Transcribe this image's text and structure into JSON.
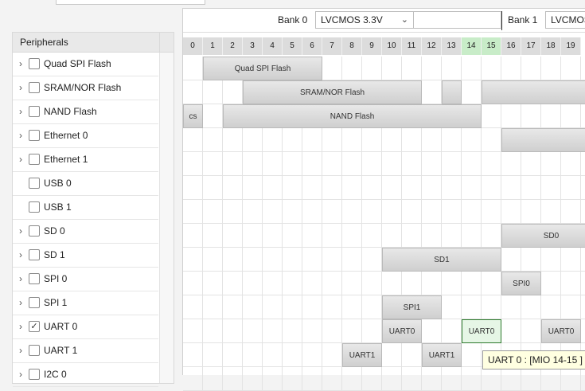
{
  "peripherals": {
    "header": "Peripherals",
    "items": [
      {
        "label": "Quad SPI Flash",
        "expandable": true,
        "checked": false
      },
      {
        "label": "SRAM/NOR Flash",
        "expandable": true,
        "checked": false
      },
      {
        "label": "NAND Flash",
        "expandable": true,
        "checked": false
      },
      {
        "label": "Ethernet 0",
        "expandable": true,
        "checked": false
      },
      {
        "label": "Ethernet 1",
        "expandable": true,
        "checked": false
      },
      {
        "label": "USB 0",
        "expandable": false,
        "checked": false
      },
      {
        "label": "USB 1",
        "expandable": false,
        "checked": false
      },
      {
        "label": "SD 0",
        "expandable": true,
        "checked": false
      },
      {
        "label": "SD 1",
        "expandable": true,
        "checked": false
      },
      {
        "label": "SPI 0",
        "expandable": true,
        "checked": false
      },
      {
        "label": "SPI 1",
        "expandable": true,
        "checked": false
      },
      {
        "label": "UART 0",
        "expandable": true,
        "checked": true
      },
      {
        "label": "UART 1",
        "expandable": true,
        "checked": false
      },
      {
        "label": "I2C 0",
        "expandable": true,
        "checked": false
      }
    ]
  },
  "banks": [
    {
      "label": "Bank 0",
      "voltage": "LVCMOS 3.3V"
    },
    {
      "label": "Bank 1",
      "voltage": "LVCMOS"
    }
  ],
  "mio_pins": [
    "0",
    "1",
    "2",
    "3",
    "4",
    "5",
    "6",
    "7",
    "8",
    "9",
    "10",
    "11",
    "12",
    "13",
    "14",
    "15",
    "16",
    "17",
    "18",
    "19"
  ],
  "highlight_pins": [
    14,
    15
  ],
  "segments": [
    {
      "row": 0,
      "from": 1,
      "to": 6,
      "label": "Quad SPI Flash"
    },
    {
      "row": 1,
      "from": 3,
      "to": 11,
      "label": "SRAM/NOR Flash"
    },
    {
      "row": 1,
      "from": 13,
      "to": 13,
      "label": ""
    },
    {
      "row": 1,
      "from": 15,
      "to": 20,
      "label": ""
    },
    {
      "row": 2,
      "from": 0,
      "to": 0,
      "label": "cs"
    },
    {
      "row": 2,
      "from": 2,
      "to": 14,
      "label": "NAND Flash"
    },
    {
      "row": 3,
      "from": 16,
      "to": 20,
      "label": ""
    },
    {
      "row": 7,
      "from": 16,
      "to": 20,
      "label": "SD0"
    },
    {
      "row": 8,
      "from": 10,
      "to": 15,
      "label": "SD1"
    },
    {
      "row": 9,
      "from": 16,
      "to": 17,
      "label": "SPI0"
    },
    {
      "row": 10,
      "from": 10,
      "to": 12,
      "label": "SPI1"
    },
    {
      "row": 11,
      "from": 10,
      "to": 11,
      "label": "UART0"
    },
    {
      "row": 11,
      "from": 14,
      "to": 15,
      "label": "UART0",
      "selected": true
    },
    {
      "row": 11,
      "from": 18,
      "to": 19,
      "label": "UART0"
    },
    {
      "row": 12,
      "from": 8,
      "to": 9,
      "label": "UART1"
    },
    {
      "row": 12,
      "from": 12,
      "to": 13,
      "label": "UART1"
    }
  ],
  "tooltip": "UART 0 : [MIO 14-15 ]"
}
